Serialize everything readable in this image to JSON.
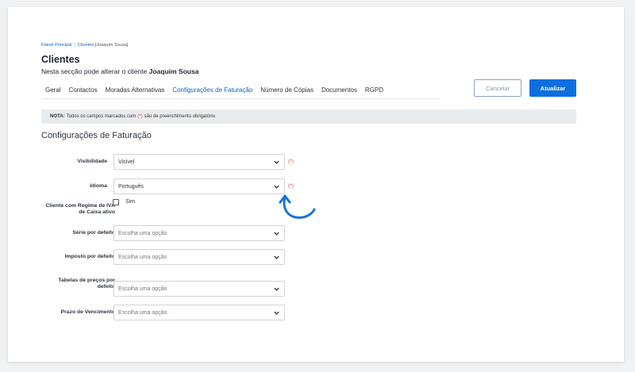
{
  "breadcrumb": {
    "home": "Painel Principal",
    "separator": "|",
    "clients": "Clientes",
    "current": "[Joaquim Sousa]"
  },
  "page": {
    "title": "Clientes",
    "subtitle_prefix": "Nesta secção pode alterar o cliente",
    "client_name": "Joaquim Sousa"
  },
  "tabs": [
    {
      "label": "Geral"
    },
    {
      "label": "Contactos"
    },
    {
      "label": "Moradas Alternativas"
    },
    {
      "label": "Configurações de Faturação",
      "active": true
    },
    {
      "label": "Número de Cópias"
    },
    {
      "label": "Documentos"
    },
    {
      "label": "RGPD"
    }
  ],
  "actions": {
    "cancel": "Cancelar",
    "update": "Atualizar"
  },
  "note": {
    "label": "NOTA:",
    "text_before": "Todos os campos marcados com",
    "required_mark": "(*)",
    "text_after": "são de preenchimento obrigatório"
  },
  "section": {
    "title": "Configurações de Faturação"
  },
  "fields": {
    "visibility": {
      "label": "Visibilidade",
      "value": "Visível",
      "required": "(*)"
    },
    "language": {
      "label": "Idioma",
      "value": "Português",
      "required": "(*)"
    },
    "vat_cash": {
      "label": "Cliente com Regime de IVA de Caixa ativo",
      "option": "Sim",
      "checked": false
    },
    "series": {
      "label": "Série por defeito",
      "value": "Escolha uma opção"
    },
    "tax": {
      "label": "Imposto por defeito",
      "value": "Escolha uma opção"
    },
    "price_tables": {
      "label": "Tabelas de preços por defeito",
      "value": "Escolha uma opção"
    },
    "due_term": {
      "label": "Prazo de Vencimento",
      "value": "Escolha uma opção"
    }
  },
  "colors": {
    "accent": "#0d6ee0",
    "link": "#0d63c4",
    "required": "#e0443d",
    "arrow": "#1a73d6"
  },
  "annotation": {
    "icon": "curved-arrow-icon"
  }
}
